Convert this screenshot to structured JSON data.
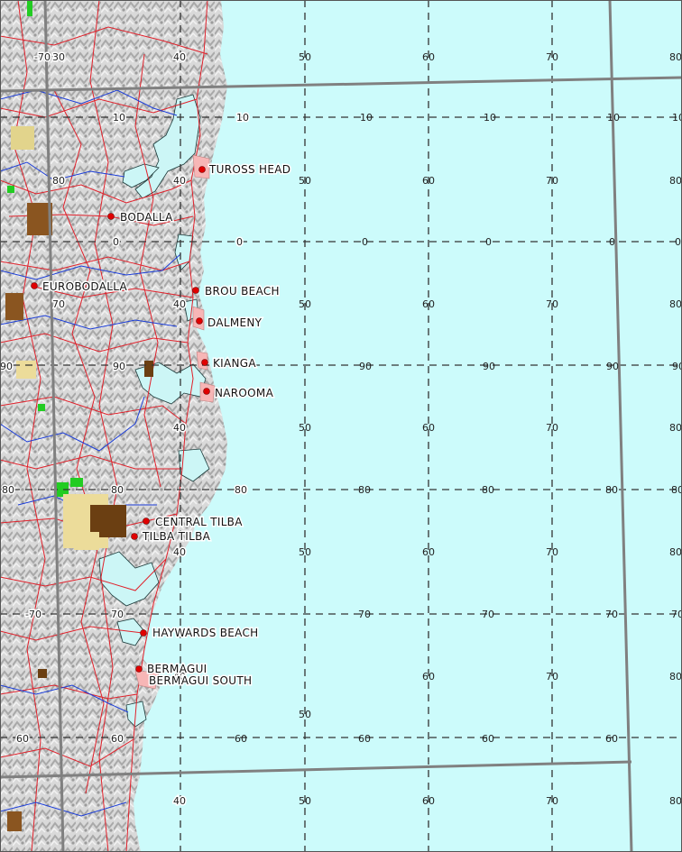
{
  "map": {
    "colors": {
      "ocean": "#ccfbfb",
      "land": "#d8d8d8",
      "roads": "#e0202a",
      "rivers": "#1a3cd8",
      "estuaries": "#ccf6f6",
      "urban": "#f7b6b6",
      "grid_dashed": "#333333",
      "grid_major": "#808080",
      "town_marker": "#e00000"
    },
    "grid_labels": {
      "row_a": [
        "-70",
        "30",
        "40",
        "50",
        "60",
        "70",
        "80"
      ],
      "row_b": [
        "10",
        "10",
        "10",
        "10",
        "10",
        "10",
        "10"
      ],
      "row_c": [
        "80",
        "40",
        "50",
        "60",
        "70",
        "80"
      ],
      "row_d": [
        "0",
        "0",
        "0",
        "0",
        "0",
        "0",
        "0"
      ],
      "row_e": [
        "70",
        "40",
        "50",
        "60",
        "70",
        "80"
      ],
      "row_f": [
        "90",
        "90",
        "90",
        "90",
        "90",
        "90"
      ],
      "row_g": [
        "40",
        "50",
        "60",
        "70",
        "80"
      ],
      "row_h": [
        "80",
        "80",
        "80",
        "80",
        "80",
        "80",
        "80",
        "80"
      ],
      "row_i": [
        "40",
        "50",
        "60",
        "70",
        "80"
      ],
      "row_j": [
        "-70",
        "70",
        "70",
        "70",
        "70",
        "70"
      ],
      "row_k": [
        "40",
        "50",
        "60",
        "70",
        "80"
      ],
      "row_l": [
        "60",
        "60",
        "60",
        "60",
        "60",
        "60"
      ],
      "row_m": [
        "40",
        "50",
        "60",
        "70",
        "80"
      ]
    },
    "towns": [
      {
        "name": "TUROSS HEAD"
      },
      {
        "name": "BODALLA"
      },
      {
        "name": "EUROBODALLA"
      },
      {
        "name": "BROU BEACH"
      },
      {
        "name": "DALMENY"
      },
      {
        "name": "KIANGA"
      },
      {
        "name": "NAROOMA"
      },
      {
        "name": "CENTRAL TILBA"
      },
      {
        "name": "TILBA TILBA"
      },
      {
        "name": "HAYWARDS BEACH"
      },
      {
        "name": "BERMAGUI"
      },
      {
        "name": "BERMAGUI SOUTH"
      }
    ]
  }
}
